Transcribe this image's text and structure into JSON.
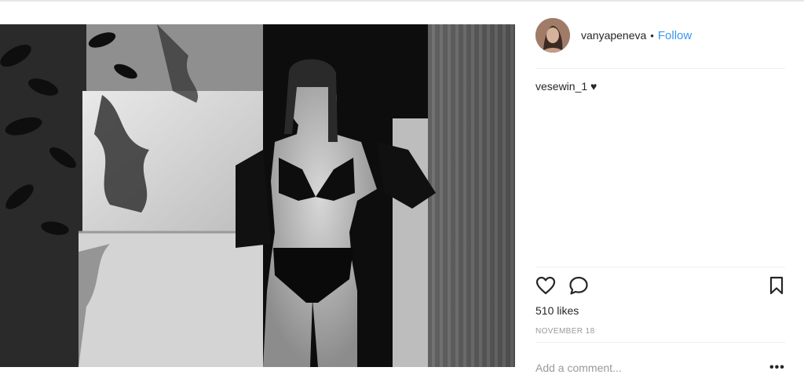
{
  "post": {
    "username": "vanyapeneva",
    "separator": "•",
    "follow_label": "Follow",
    "caption_text": "vesewin_1",
    "caption_emoji": "♥",
    "likes": "510 likes",
    "date": "NOVEMBER 18",
    "comment_placeholder": "Add a comment...",
    "more_label": "•••"
  },
  "icons": {
    "like": "heart-icon",
    "comment": "comment-icon",
    "save": "bookmark-icon",
    "more": "more-options-icon"
  },
  "colors": {
    "link_blue": "#3897f0",
    "text": "#262626",
    "muted": "#999999",
    "divider": "#efefef"
  }
}
